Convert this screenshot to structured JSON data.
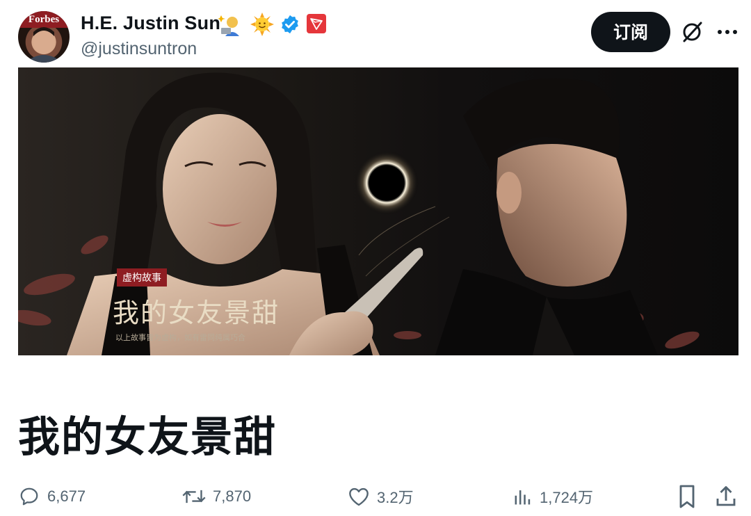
{
  "author": {
    "display_name": "H.E. Justin Sun",
    "handle": "@justinsuntron",
    "avatar_label": "Forbes",
    "badges": [
      "technologist-emoji",
      "sun-emoji",
      "verified-badge",
      "tron-icon"
    ]
  },
  "header": {
    "subscribe_label": "订阅",
    "grok_icon": "grok-slash-circle-icon",
    "more_icon": "more-dots-icon"
  },
  "cover": {
    "tag_label": "虚构故事",
    "headline": "我的女友景甜",
    "disclaimer": "以上故事皆为虚构，如有雷同纯属巧合"
  },
  "article": {
    "title": "我的女友景甜"
  },
  "actions": {
    "replies": "6,677",
    "reposts": "7,870",
    "likes": "3.2万",
    "views": "1,724万"
  },
  "colors": {
    "text": "#0f1419",
    "muted": "#536471",
    "verified": "#1d9bf0",
    "tron": "#e5363b",
    "tag_bg": "#8e1d22"
  }
}
